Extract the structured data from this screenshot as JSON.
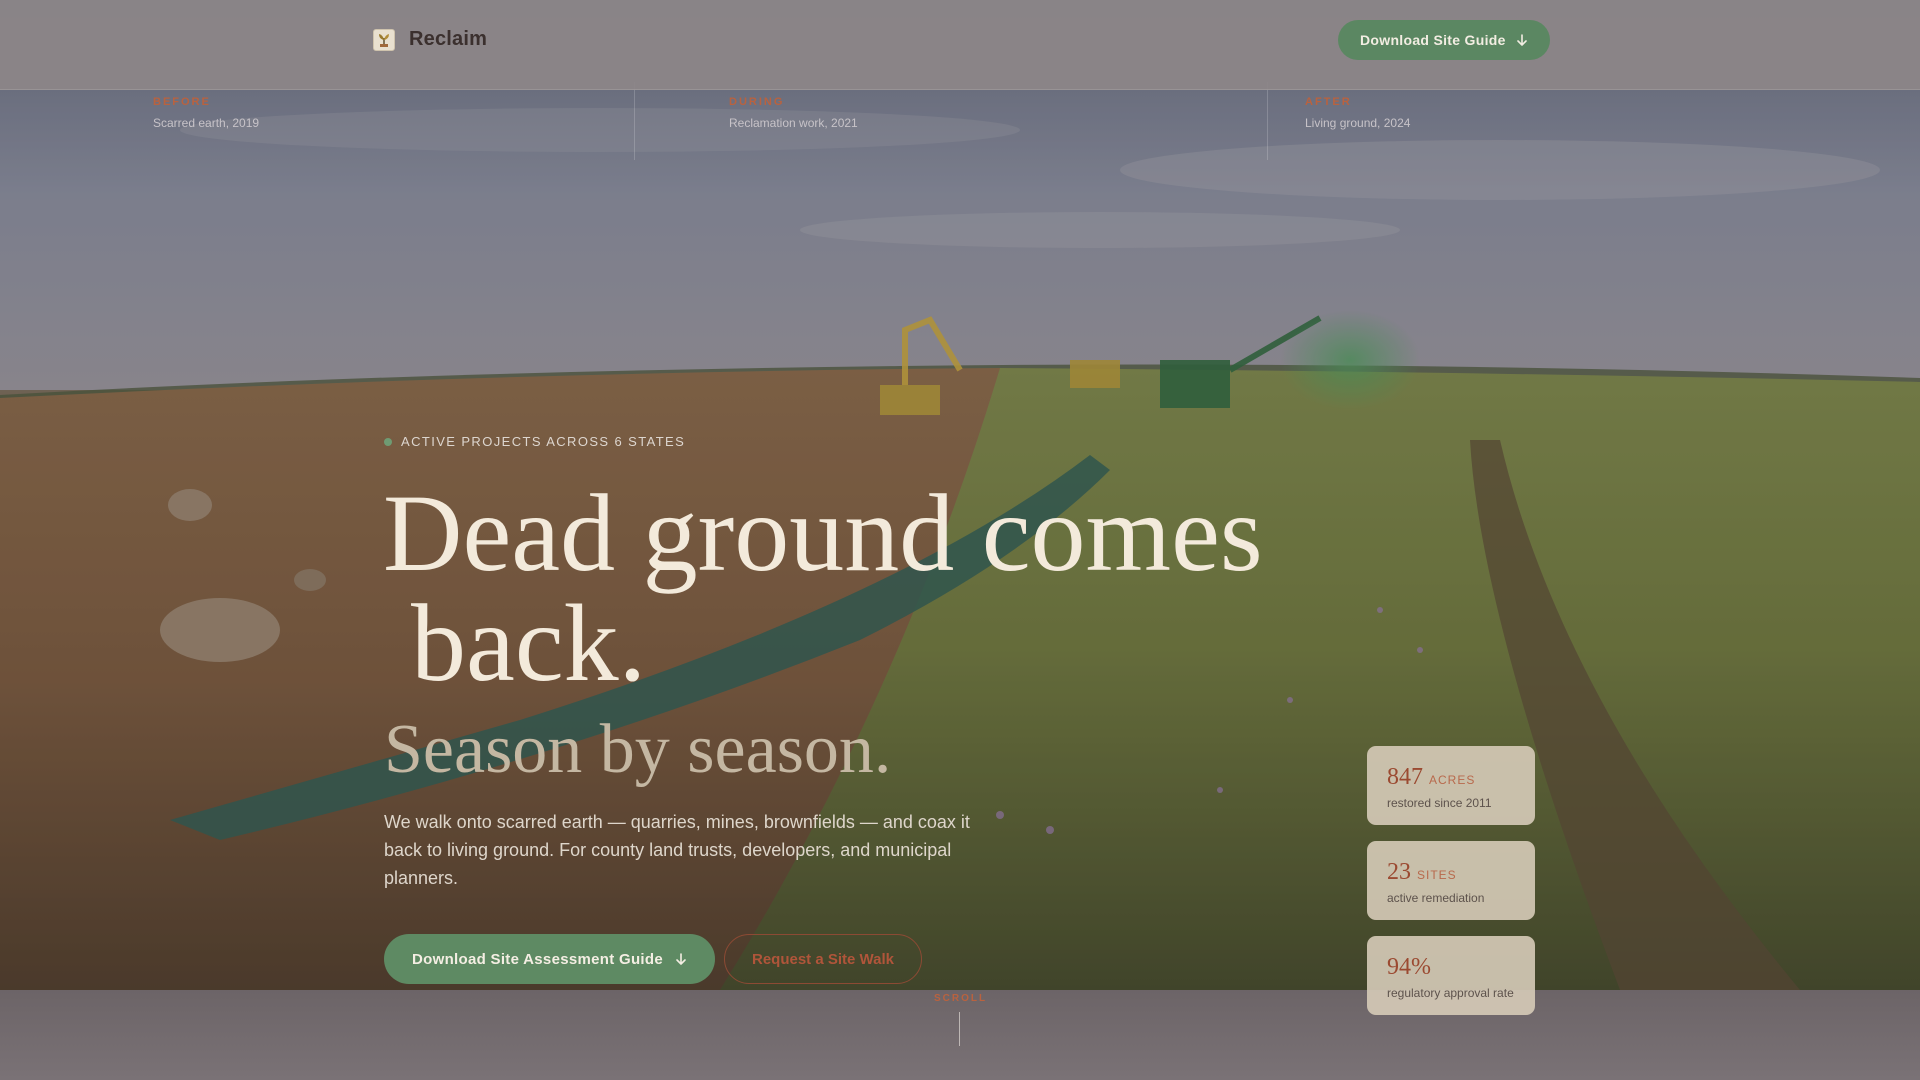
{
  "nav": {
    "brand": "Reclaim",
    "cta_label": "Download Site Guide",
    "cta_icon": "arrow-down-icon"
  },
  "timeline": [
    {
      "label": "BEFORE",
      "description": "Scarred earth, 2019"
    },
    {
      "label": "DURING",
      "description": "Reclamation work, 2021"
    },
    {
      "label": "AFTER",
      "description": "Living ground, 2024"
    }
  ],
  "hero": {
    "eyebrow": "ACTIVE PROJECTS ACROSS 6 STATES",
    "headline_line1": "Dead ground comes",
    "headline_line2": "back.",
    "subhead": "Season by season.",
    "lede": "We walk onto scarred earth — quarries, mines, brownfields — and coax it back to living ground. For county land trusts, developers, and municipal planners.",
    "primary_cta": "Download Site Assessment Guide",
    "secondary_cta": "Request a Site Walk"
  },
  "stats": [
    {
      "value": "847",
      "unit": "ACRES",
      "caption": "restored since 2011"
    },
    {
      "value": "23",
      "unit": "SITES",
      "caption": "active remediation"
    },
    {
      "value": "94%",
      "unit": "",
      "caption": "regulatory approval rate"
    }
  ],
  "scroll_label": "SCROLL",
  "colors": {
    "accent_green": "#5e8a63",
    "accent_rust": "#b9623f",
    "headline": "#f3eadb"
  }
}
